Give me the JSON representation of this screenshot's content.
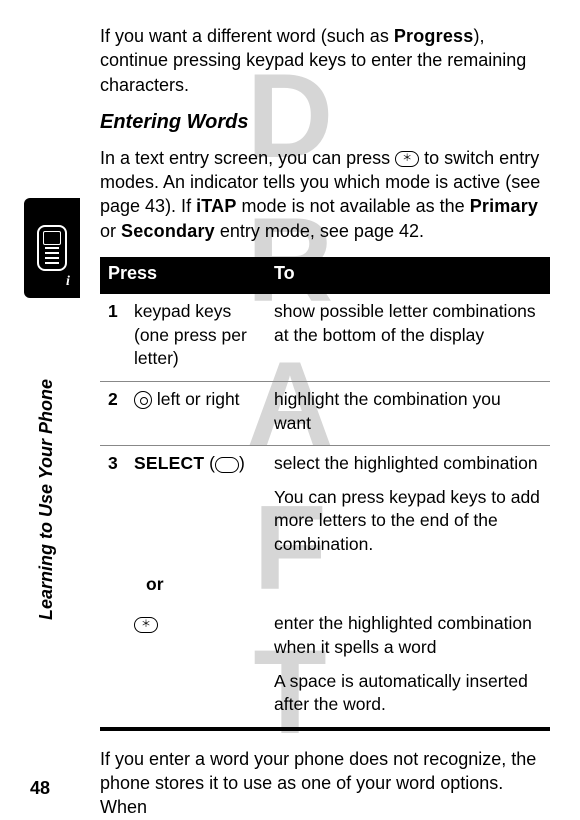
{
  "watermark": "DRAFT",
  "side_label": "Learning to Use Your Phone",
  "page_number": "48",
  "intro_para": {
    "pre": "If you want a different word (such as ",
    "word": "Progress",
    "post": "), continue pressing keypad keys to enter the remaining characters."
  },
  "heading": "Entering Words",
  "mode_para": {
    "p1": "In a text entry screen, you can press ",
    "p2": " to switch entry modes. An indicator tells you which mode is active (see page 43). If ",
    "itap": "iTAP",
    "p3": " mode is not available as the ",
    "primary": "Primary",
    "p4": " or ",
    "secondary": "Secondary",
    "p5": " entry mode, see page 42."
  },
  "table": {
    "head_press": "Press",
    "head_to": "To",
    "rows": {
      "r1": {
        "num": "1",
        "press": "keypad keys (one press per letter)",
        "to": "show possible letter combinations at the bottom of the display"
      },
      "r2": {
        "num": "2",
        "press_suffix": " left or right",
        "to": " highlight the combination you want"
      },
      "r3": {
        "num": "3",
        "select": "SELECT",
        "to_a": "select the highlighted combination",
        "to_b": "You can press keypad keys to add more letters to the end of the combination.",
        "or": "or",
        "to_c": "enter the highlighted combination when it spells a word",
        "to_d": "A space is automatically inserted after the word."
      }
    }
  },
  "outro": "If you enter a word your phone does not recognize, the phone stores it to use as one of your word options. When",
  "star_glyph": "＊",
  "info_i": "i"
}
